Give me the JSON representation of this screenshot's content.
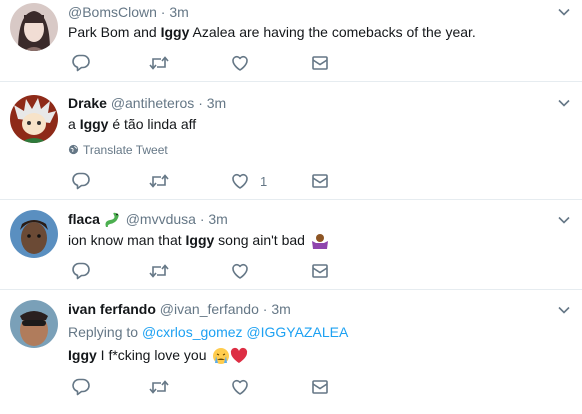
{
  "tweets": [
    {
      "name": "",
      "handle": "@BomsClown",
      "time": "3m",
      "text_parts": [
        "Park Bom and ",
        "Iggy",
        " Azalea are having the comebacks of the year."
      ],
      "like_count": ""
    },
    {
      "name": "Drake",
      "handle": "@antiheteros",
      "time": "3m",
      "text_parts": [
        "a ",
        "Iggy",
        " é tão linda aff"
      ],
      "translate_label": "Translate Tweet",
      "like_count": "1"
    },
    {
      "name": "flaca",
      "handle": "@mvvdusa",
      "time": "3m",
      "text_parts": [
        "ion know man that ",
        "Iggy",
        " song ain't bad"
      ],
      "like_count": ""
    },
    {
      "name": "ivan ferfando",
      "handle": "@ivan_ferfando",
      "time": "3m",
      "reply_prefix": "Replying to",
      "reply_handles": [
        "@cxrlos_gomez",
        "@IGGYAZALEA"
      ],
      "text_parts": [
        "Iggy",
        " I f*cking love you"
      ],
      "like_count": ""
    }
  ],
  "separator": "·",
  "icons": {
    "reply": "reply-icon",
    "retweet": "retweet-icon",
    "like": "heart-icon",
    "dm": "envelope-icon",
    "more": "chevron-down-icon",
    "translate": "globe-icon"
  },
  "colors": {
    "name": "#14171a",
    "secondary": "#657786",
    "link": "#1da1f2",
    "border": "#e6ecf0"
  }
}
